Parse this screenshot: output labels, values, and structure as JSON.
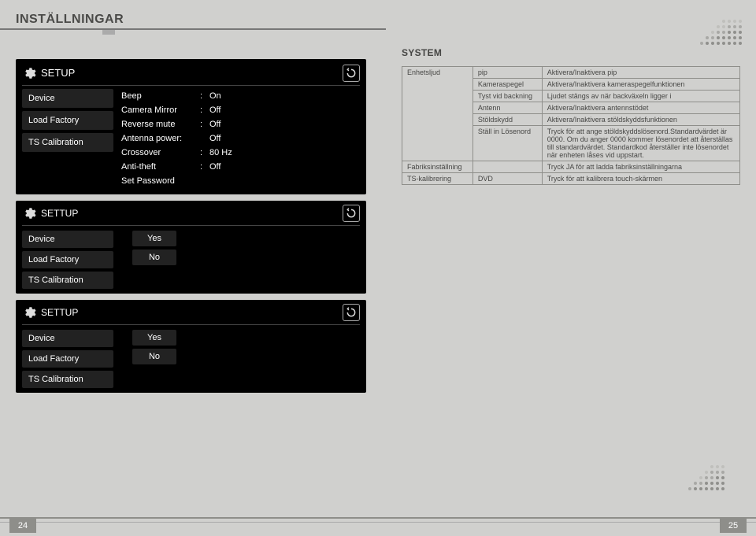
{
  "pageTitle": "INSTÄLLNINGAR",
  "setup": {
    "title": "SETUP",
    "sidebar": [
      "Device",
      "Load Factory",
      "TS Calibration"
    ],
    "settings": [
      {
        "label": "Beep",
        "value": "On"
      },
      {
        "label": "Camera Mirror",
        "value": "Off"
      },
      {
        "label": "Reverse mute",
        "value": "Off"
      },
      {
        "label": "Antenna power:",
        "value": "Off",
        "nocolon": true
      },
      {
        "label": "Crossover",
        "value": "80 Hz"
      },
      {
        "label": "Anti-theft",
        "value": "Off"
      },
      {
        "label": "Set Password",
        "value": "",
        "nocolon": true
      }
    ]
  },
  "compact1": {
    "title": "SETTUP",
    "sidebar": [
      "Device",
      "Load Factory",
      "TS Calibration"
    ],
    "values": [
      "Yes",
      "No"
    ]
  },
  "compact2": {
    "title": "SETTUP",
    "sidebar": [
      "Device",
      "Load Factory",
      "TS Calibration"
    ],
    "values": [
      "Yes",
      "No"
    ]
  },
  "systemHeading": "SYSTEM",
  "systemTable": {
    "rows": [
      {
        "c1": "Enhetsljud",
        "c2": "pip",
        "c3": "Aktivera/Inaktivera pip"
      },
      {
        "c1": "",
        "c1span": true,
        "c2": "Kameraspegel",
        "c3": "Aktivera/Inaktivera kameraspegelfunktionen"
      },
      {
        "c1": "",
        "c1span": true,
        "c2": "Tyst vid backning",
        "c3": "Ljudet stängs av när backväxeln ligger i"
      },
      {
        "c1": "",
        "c1span": true,
        "c2": "Antenn",
        "c3": "Aktivera/Inaktivera antennstödet"
      },
      {
        "c1": "",
        "c1span": true,
        "c2": "Stöldskydd",
        "c3": "Aktivera/Inaktivera stöldskyddsfunktionen"
      },
      {
        "c1": "",
        "c1span": true,
        "c2": "Ställ in Lösenord",
        "c3": "Tryck för att ange stöldskyddslösenord.Standardvärdet är 0000. Om du anger 0000 kommer lösenordet att återställas till standardvärdet. Standardkod återställer inte lösenordet när enheten låses vid uppstart."
      },
      {
        "c1": "Fabriksinställning",
        "c2": "",
        "c2span": true,
        "c3": "Tryck JA för att ladda fabriksinställningarna"
      },
      {
        "c1": "TS-kalibrering",
        "c2": "DVD",
        "c3": "Tryck för att kalibrera touch-skärmen"
      }
    ]
  },
  "pageLeft": "24",
  "pageRight": "25"
}
